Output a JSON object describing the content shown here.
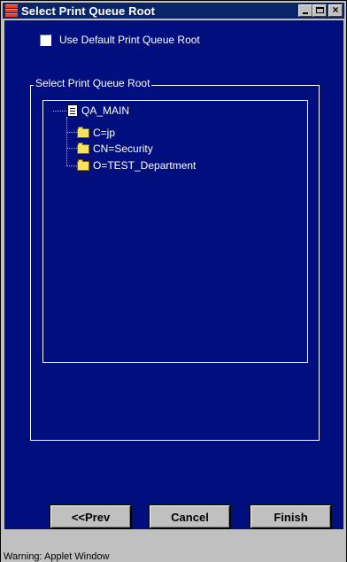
{
  "window": {
    "title": "Select Print Queue Root",
    "controls": {
      "minimize_icon": "minimize-icon",
      "maximize_icon": "maximize-icon",
      "close_icon": "close-icon"
    }
  },
  "options": {
    "use_default_label": "Use Default Print Queue Root",
    "use_default_checked": false
  },
  "group": {
    "title": "Select Print Queue Root"
  },
  "tree": {
    "root": {
      "label": "QA_MAIN",
      "icon": "tree-root-icon"
    },
    "children": [
      {
        "label": "C=jp",
        "icon": "folder-icon"
      },
      {
        "label": "CN=Security",
        "icon": "folder-icon"
      },
      {
        "label": "O=TEST_Department",
        "icon": "folder-icon"
      }
    ]
  },
  "buttons": {
    "prev": "<<Prev",
    "cancel": "Cancel",
    "finish": "Finish"
  },
  "status": {
    "text": "Warning: Applet Window"
  },
  "colors": {
    "titlebar": "#0a246a",
    "client_bg": "#000f7d",
    "chrome": "#c0c0c0"
  }
}
